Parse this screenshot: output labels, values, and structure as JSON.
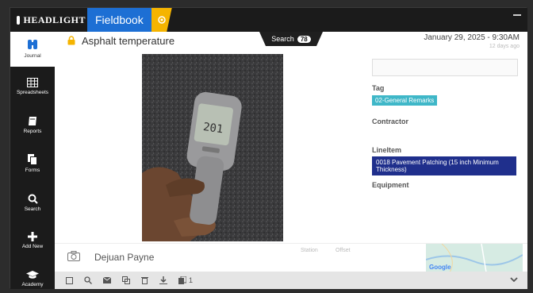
{
  "app": {
    "brand": "HEADLIGHT",
    "title": "Fieldbook"
  },
  "nav": [
    {
      "label": "Journal",
      "icon": "binoculars-icon"
    },
    {
      "label": "Spreadsheets",
      "icon": "grid-icon"
    },
    {
      "label": "Reports",
      "icon": "book-icon"
    },
    {
      "label": "Forms",
      "icon": "document-icon"
    },
    {
      "label": "Search",
      "icon": "search-icon"
    },
    {
      "label": "Add New",
      "icon": "plus-icon"
    },
    {
      "label": "Academy",
      "icon": "graduation-cap-icon"
    }
  ],
  "entry": {
    "title": "Asphalt temperature",
    "date": "January 29, 2025 - 9:30AM",
    "ago": "12 days ago",
    "author": "Dejuan Payne",
    "station_label": "Station",
    "offset_label": "Offset"
  },
  "search": {
    "label": "Search",
    "count": "78"
  },
  "details": {
    "tag_label": "Tag",
    "tag_value": "02-General Remarks",
    "contractor_label": "Contractor",
    "lineitem_label": "LineItem",
    "lineitem_value": "0018 Pavement Patching (15 inch Minimum Thickness)",
    "equipment_label": "Equipment"
  },
  "photo": {
    "thermometer_reading": "201"
  },
  "map": {
    "provider": "Google"
  },
  "toolbar": {
    "attachments_count": "1"
  },
  "colors": {
    "accent_blue": "#1d6fd4",
    "accent_yellow": "#f5b400",
    "tag_teal": "#3fb7c8",
    "lineitem_navy": "#1f2f8c"
  }
}
